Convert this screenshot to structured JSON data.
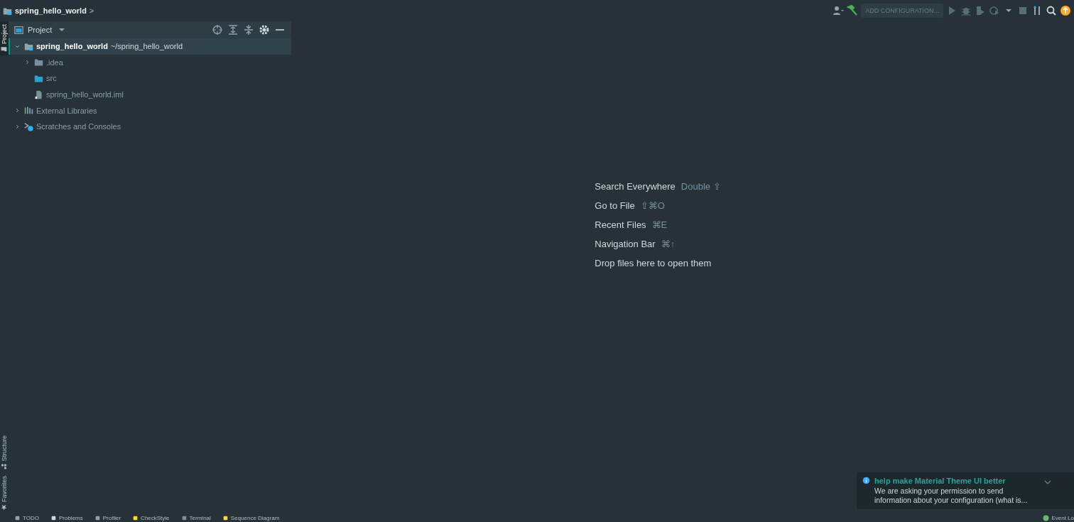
{
  "navbar": {
    "crumb": "spring_hello_world",
    "separator": ">"
  },
  "toolbar": {
    "run_config": "ADD CONFIGURATION..."
  },
  "side_tabs_top": [
    {
      "label": "Project",
      "selected": true
    }
  ],
  "side_tabs_bottom": [
    {
      "label": "Structure",
      "selected": false
    },
    {
      "label": "Favorites",
      "selected": false
    }
  ],
  "project_panel": {
    "title": "Project",
    "tree": [
      {
        "kind": "module",
        "label": "spring_hello_world",
        "path": "~/spring_hello_world",
        "expanded": true,
        "selected": true,
        "children": [
          {
            "kind": "folder",
            "label": ".idea",
            "expanded": false,
            "selected": false
          },
          {
            "kind": "source",
            "label": "src",
            "selected": false
          },
          {
            "kind": "file",
            "label": "spring_hello_world.iml",
            "selected": false
          }
        ]
      },
      {
        "kind": "libraries",
        "label": "External Libraries",
        "expanded": false,
        "selected": false
      },
      {
        "kind": "scratches",
        "label": "Scratches and Consoles",
        "expanded": false,
        "selected": false
      }
    ]
  },
  "hints": [
    {
      "action": "Search Everywhere",
      "shortcut": "Double ⇧"
    },
    {
      "action": "Go to File",
      "shortcut": "⇧⌘O"
    },
    {
      "action": "Recent Files",
      "shortcut": "⌘E"
    },
    {
      "action": "Navigation Bar",
      "shortcut": "⌘↑"
    },
    {
      "action": "Drop files here to open them"
    }
  ],
  "notification": {
    "title": "help make Material Theme UI better",
    "body": "We are asking your permission to send information about your configuration (what is..."
  },
  "bottom_tabs": [
    {
      "label": "TODO"
    },
    {
      "label": "Problems"
    },
    {
      "label": "Profiler"
    },
    {
      "label": "CheckStyle"
    },
    {
      "label": "Terminal"
    },
    {
      "label": "Sequence Diagram"
    }
  ],
  "event_log": "Event Lo"
}
